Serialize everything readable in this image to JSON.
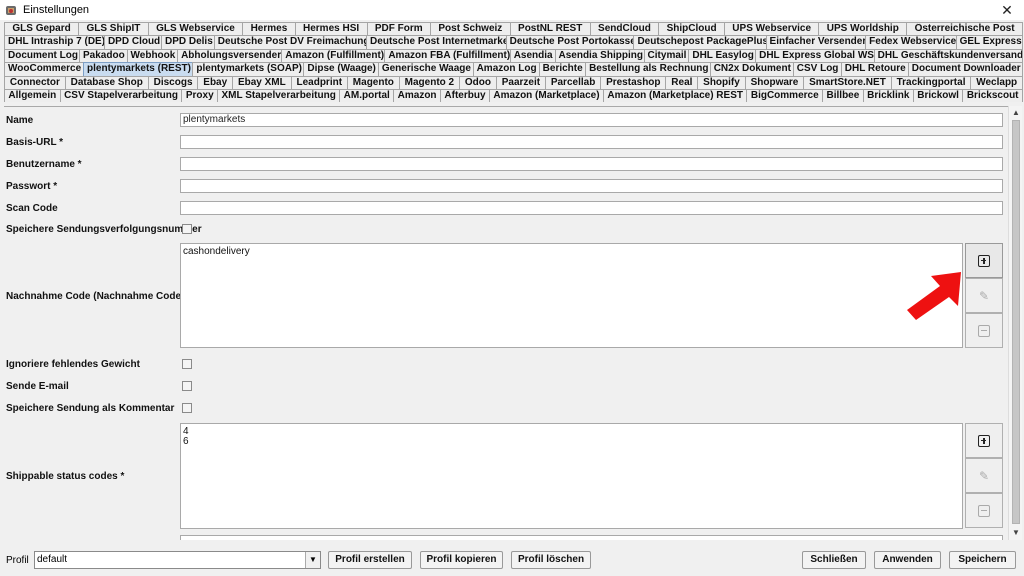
{
  "window": {
    "title": "Einstellungen",
    "close_glyph": "✕"
  },
  "tabs": {
    "rows": [
      [
        "GLS Gepard",
        "GLS ShipIT",
        "GLS Webservice",
        "Hermes",
        "Hermes HSI",
        "PDF Form",
        "Post Schweiz",
        "PostNL REST",
        "SendCloud",
        "ShipCloud",
        "UPS Webservice",
        "UPS Worldship",
        "Österreichische Post"
      ],
      [
        "DHL Intraship 7 (DE)",
        "DPD Cloud",
        "DPD Delis",
        "Deutsche Post DV Freimachung",
        "Deutsche Post Internetmarke",
        "Deutsche Post Portokasse",
        "Deutschepost PackagePlus",
        "Einfacher Versender",
        "Fedex Webservice",
        "GEL Express"
      ],
      [
        "Document Log",
        "Pakadoo",
        "Webhook",
        "Abholungsversender",
        "Amazon (Fulfillment)",
        "Amazon FBA (Fulfillment)",
        "Asendia",
        "Asendia Shipping",
        "Citymail",
        "DHL Easylog",
        "DHL Express Global WS",
        "DHL Geschäftskundenversand"
      ],
      [
        "WooCommerce",
        "plentymarkets (REST)",
        "plentymarkets (SOAP)",
        "Dipse (Waage)",
        "Generische Waage",
        "Amazon Log",
        "Berichte",
        "Bestellung als Rechnung",
        "CN2x Dokument",
        "CSV Log",
        "DHL Retoure",
        "Document Downloader"
      ],
      [
        "Connector",
        "Database Shop",
        "Discogs",
        "Ebay",
        "Ebay XML",
        "Leadprint",
        "Magento",
        "Magento 2",
        "Odoo",
        "Paarzeit",
        "Parcellab",
        "Prestashop",
        "Real",
        "Shopify",
        "Shopware",
        "SmartStore.NET",
        "Trackingportal",
        "Weclapp"
      ],
      [
        "Allgemein",
        "CSV Stapelverarbeitung",
        "Proxy",
        "XML Stapelverarbeitung",
        "AM.portal",
        "Amazon",
        "Afterbuy",
        "Amazon (Marketplace)",
        "Amazon (Marketplace) REST",
        "BigCommerce",
        "Billbee",
        "Bricklink",
        "Brickowl",
        "Brickscout"
      ]
    ],
    "selected": "plentymarkets (REST)"
  },
  "form": {
    "name_label": "Name",
    "name_value": "plentymarkets",
    "base_url_label": "Basis-URL *",
    "base_url_value": "",
    "username_label": "Benutzername *",
    "username_value": "",
    "password_label": "Passwort *",
    "password_value": "",
    "scan_code_label": "Scan Code",
    "scan_code_value": "",
    "save_tracking_label": "Speichere Sendungsverfolgungsnummer",
    "cod_label": "Nachnahme Code (Nachnahme Code)",
    "cod_values": [
      "cashondelivery"
    ],
    "ignore_weight_label": "Ignoriere fehlendes Gewicht",
    "send_email_label": "Sende E-mail",
    "save_as_comment_label": "Speichere Sendung als Kommentar",
    "shippable_label": "Shippable status codes *",
    "shippable_values": [
      "4",
      "6"
    ]
  },
  "bottom": {
    "profile_label": "Profil",
    "profile_value": "default",
    "create_profile": "Profil erstellen",
    "copy_profile": "Profil kopieren",
    "delete_profile": "Profil löschen",
    "close": "Schließen",
    "apply": "Anwenden",
    "save": "Speichern"
  },
  "colors": {
    "selected_tab": "#c9dcf0",
    "arrow": "#ee1111"
  }
}
